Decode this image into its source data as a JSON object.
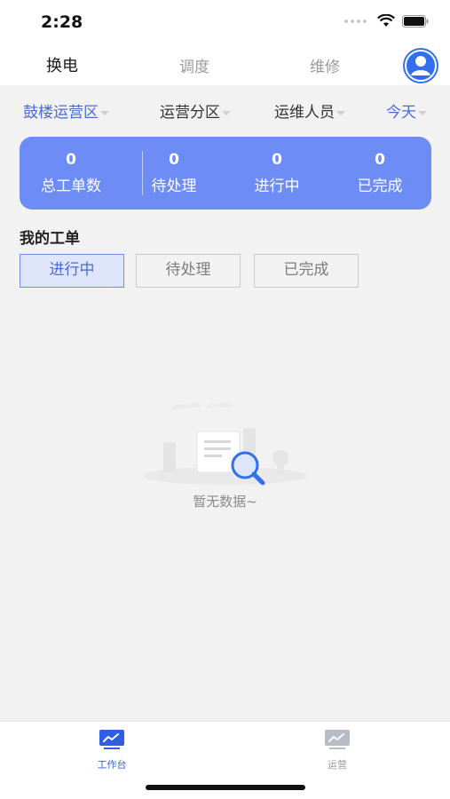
{
  "status_bar": {
    "time": "2:28"
  },
  "top_nav": {
    "tabs": [
      {
        "label": "换电",
        "active": true
      },
      {
        "label": "调度",
        "active": false
      },
      {
        "label": "维修",
        "active": false
      }
    ],
    "avatar_icon": "user-avatar-icon"
  },
  "filters": [
    {
      "label": "鼓楼运营区",
      "color": "#4a6bd8"
    },
    {
      "label": "运营分区",
      "color": "#333333"
    },
    {
      "label": "运维人员",
      "color": "#333333"
    },
    {
      "label": "今天",
      "color": "#4a6bd8"
    }
  ],
  "stats": [
    {
      "value": "0",
      "label": "总工单数"
    },
    {
      "value": "0",
      "label": "待处理"
    },
    {
      "value": "0",
      "label": "进行中"
    },
    {
      "value": "0",
      "label": "已完成"
    }
  ],
  "my_orders": {
    "title": "我的工单",
    "segments": [
      {
        "label": "进行中",
        "active": true
      },
      {
        "label": "待处理",
        "active": false
      },
      {
        "label": "已完成",
        "active": false
      }
    ]
  },
  "empty_state": {
    "text": "暂无数据~",
    "icon": "magnifier-document-icon"
  },
  "bottom_tabs": [
    {
      "label": "工作台",
      "active": true,
      "icon": "workbench-chart-icon"
    },
    {
      "label": "运营",
      "active": false,
      "icon": "operations-chart-icon"
    }
  ],
  "colors": {
    "accent": "#6d8cf5",
    "accent_text": "#4a6bd8",
    "avatar": "#2f6ff0"
  }
}
